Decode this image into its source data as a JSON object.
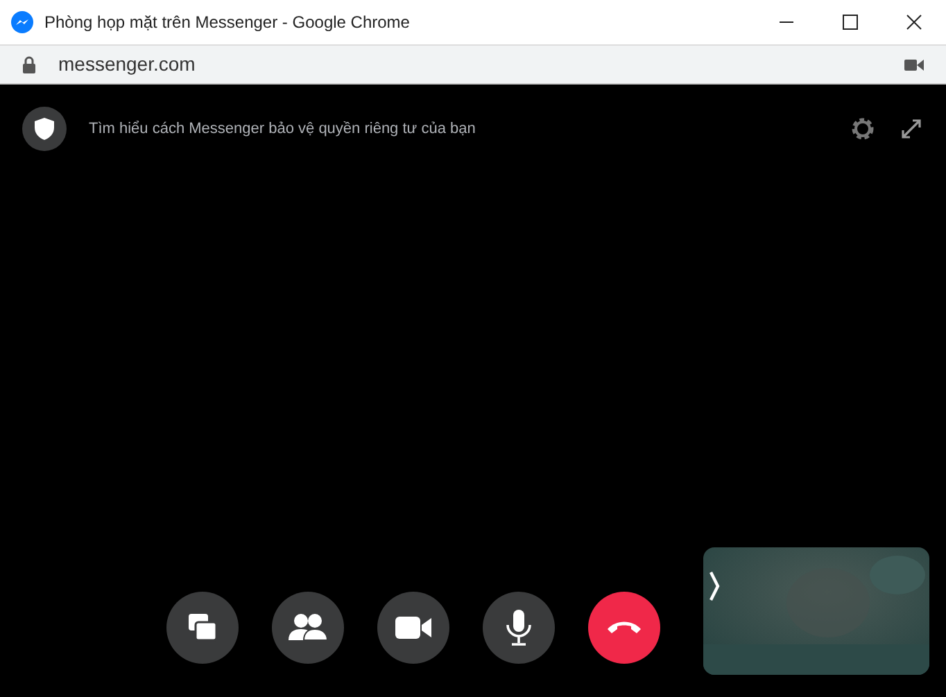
{
  "window": {
    "title": "Phòng họp mặt trên Messenger - Google Chrome"
  },
  "address_bar": {
    "url": "messenger.com"
  },
  "privacy_notice": {
    "text": "Tìm hiểu cách Messenger bảo vệ quyền riêng tư của bạn"
  },
  "call_controls": [
    {
      "kind": "screen"
    },
    {
      "kind": "people"
    },
    {
      "kind": "video"
    },
    {
      "kind": "mic"
    },
    {
      "kind": "end"
    }
  ]
}
